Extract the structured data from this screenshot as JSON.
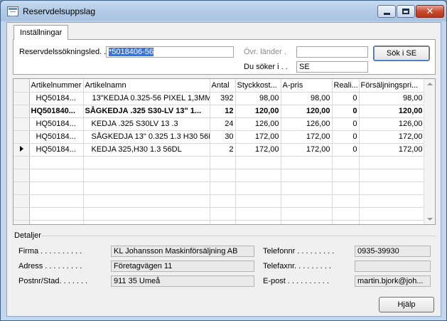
{
  "window": {
    "title": "Reservdelsuppslag"
  },
  "tabs": [
    {
      "label": "Inställningar"
    }
  ],
  "settings": {
    "search_label": "Reservdelssökningsled. .",
    "search_value": "*5018406-56",
    "other_countries_label": "Övr. länder .",
    "other_countries_value": "",
    "searching_in_label": "Du söker i . .",
    "searching_in_value": "SE",
    "search_button": "Sök i SE"
  },
  "table": {
    "columns": [
      "Artikelnummer",
      "Artikelnamn",
      "Antal",
      "Styckkost...",
      "A-pris",
      "Reali...",
      "Försäljningspri..."
    ],
    "rows": [
      {
        "marker": "",
        "bold": false,
        "cells": [
          "HQ50184...",
          "13\"KEDJA 0.325-56 PIXEL 1,3MM",
          "392",
          "98,00",
          "98,00",
          "0",
          "98,00"
        ]
      },
      {
        "marker": "",
        "bold": true,
        "cells": [
          "HQ501840...",
          "SÅGKEDJA .325 S30-LV 13\" 1...",
          "12",
          "120,00",
          "120,00",
          "0",
          "120,00"
        ]
      },
      {
        "marker": "",
        "bold": false,
        "cells": [
          "HQ50184...",
          "KEDJA .325 S30LV  13 .3",
          "24",
          "126,00",
          "126,00",
          "0",
          "126,00"
        ]
      },
      {
        "marker": "",
        "bold": false,
        "cells": [
          "HQ50184...",
          "SÅGKEDJA 13\" 0.325 1.3 H30 56E",
          "30",
          "172,00",
          "172,00",
          "0",
          "172,00"
        ]
      },
      {
        "marker": "current",
        "bold": false,
        "cells": [
          "HQ50184...",
          "KEDJA 325,H30 1.3 56DL",
          "2",
          "172,00",
          "172,00",
          "0",
          "172,00"
        ]
      }
    ],
    "empty_rows": 8
  },
  "details": {
    "title": "Detaljer",
    "firma_label": "Firma . . . . . . . . . .",
    "firma_value": "KL Johansson Maskinförsäljning AB",
    "adress_label": "Adress . . . . . . . . .",
    "adress_value": "Företagvägen 11",
    "postnr_label": "Postnr/Stad. . . . . . .",
    "postnr_value": "911 35  Umeå",
    "telefon_label": "Telefonnr . . . . . . . . .",
    "telefon_value": "0935-39930",
    "telefax_label": "Telefaxnr. . . . . . . . .",
    "telefax_value": "",
    "epost_label": "E-post . . . . . . . . . .",
    "epost_value": "martin.bjork@joh..."
  },
  "footer": {
    "help_button": "Hjälp"
  }
}
